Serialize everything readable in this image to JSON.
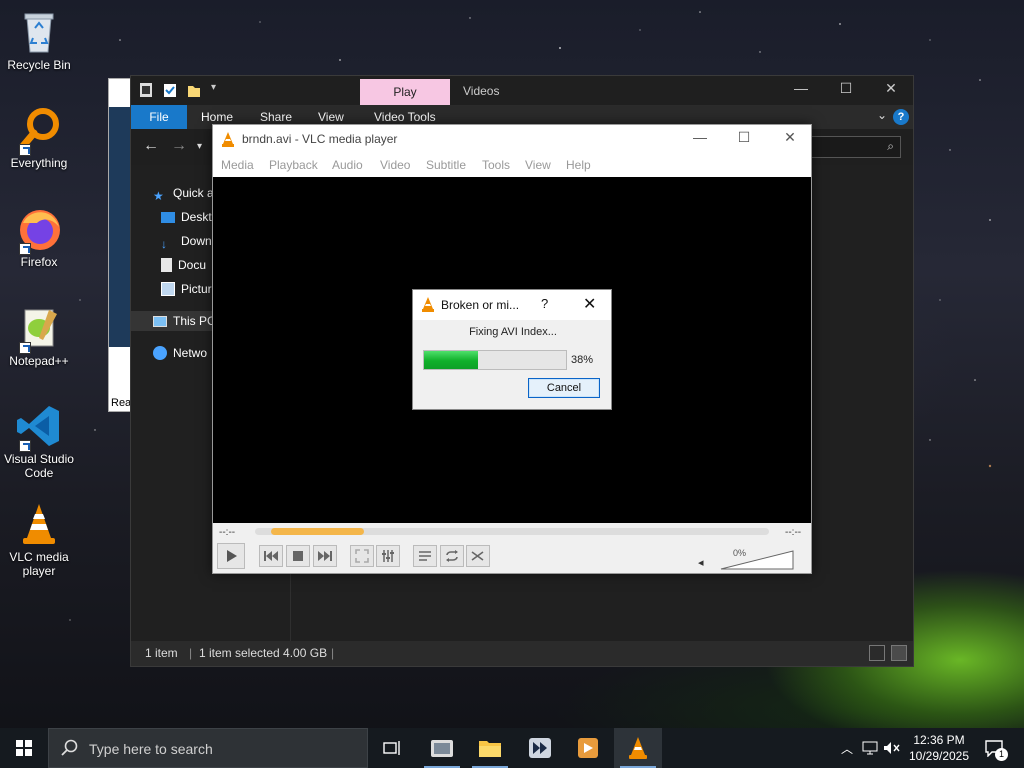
{
  "desktop": {
    "icons": [
      {
        "label": "Recycle Bin"
      },
      {
        "label": "Everything"
      },
      {
        "label": "Firefox"
      },
      {
        "label": "Notepad++"
      },
      {
        "label": "Visual Studio Code"
      },
      {
        "label": "VLC media player"
      }
    ]
  },
  "explorer": {
    "contextual_tab": "Play",
    "title": "Videos",
    "ribbon_tabs": [
      "File",
      "Home",
      "Share",
      "View",
      "Video Tools"
    ],
    "nav_items": [
      "Quick a",
      "Deskt",
      "Down",
      "Docu",
      "Pictur",
      "This PC",
      "Netwo"
    ],
    "status": {
      "item_count": "1 item",
      "selection": "1 item selected  4.00 GB"
    }
  },
  "behind_window": {
    "text": "Rea"
  },
  "vlc": {
    "title": "brndn.avi - VLC media player",
    "menu": [
      "Media",
      "Playback",
      "Audio",
      "Video",
      "Subtitle",
      "Tools",
      "View",
      "Help"
    ],
    "time_elapsed": "--:--",
    "time_total": "--:--",
    "volume_label": "0%",
    "seek_progress": 0.18
  },
  "dialog": {
    "title": "Broken or mi...",
    "help": "?",
    "message": "Fixing AVI Index...",
    "progress_percent": 38,
    "progress_label": "38%",
    "cancel_label": "Cancel"
  },
  "taskbar": {
    "search_placeholder": "Type here to search",
    "time": "12:36 PM",
    "date": "10/29/2025",
    "notification_count": "1"
  },
  "colors": {
    "accent": "#1979ca",
    "progress_green": "#10b02a",
    "play_tab_pink": "#f7c7e3",
    "vlc_orange": "#f08c00"
  }
}
